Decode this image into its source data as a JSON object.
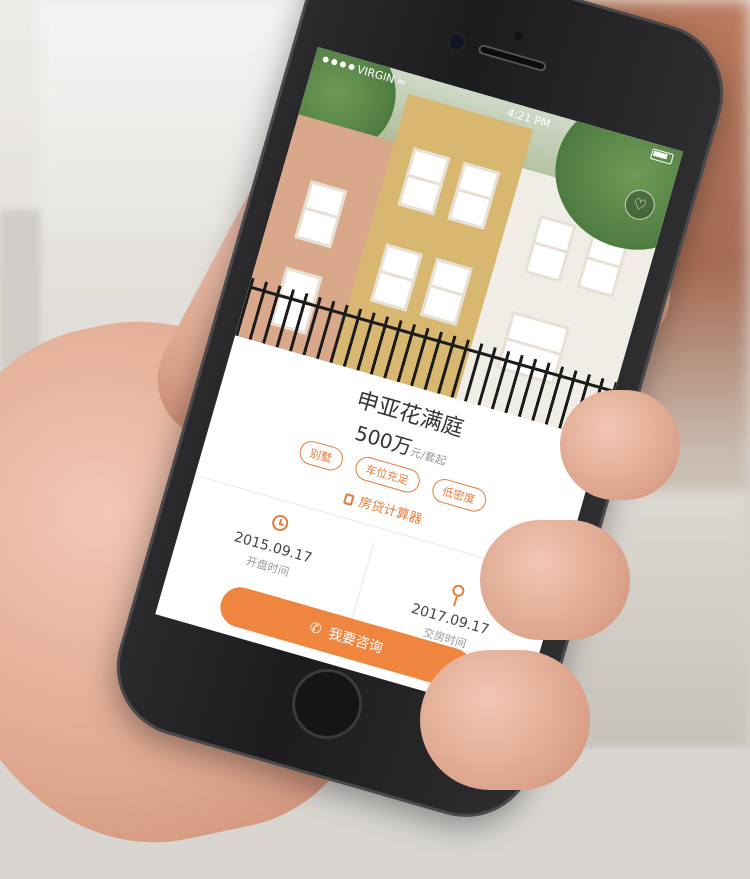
{
  "status_bar": {
    "carrier": "VIRGIN",
    "time": "4:21 PM"
  },
  "property": {
    "name": "申亚花满庭",
    "price": "500万",
    "price_unit": "元/套起",
    "tags": [
      "别墅",
      "车位充足",
      "低密度"
    ],
    "calculator_label": "房贷计算器"
  },
  "dates": {
    "opening": {
      "value": "2015.09.17",
      "label": "开盘时间"
    },
    "delivery": {
      "value": "2017.09.17",
      "label": "交房时间"
    }
  },
  "actions": {
    "consult_label": "我要咨询"
  },
  "colors": {
    "accent": "#e47d3c",
    "button": "#f0853f"
  },
  "icons": {
    "favorite": "heart-icon",
    "calculator": "calculator-icon",
    "opening": "clock-icon",
    "delivery": "key-icon",
    "consult": "phone-icon"
  }
}
